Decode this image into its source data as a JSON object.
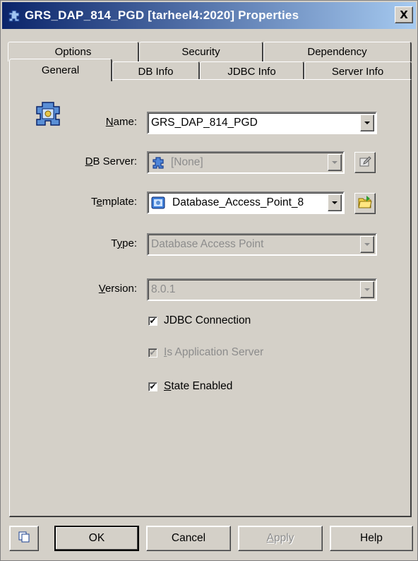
{
  "window": {
    "title": "GRS_DAP_814_PGD [tarheel4:2020] Properties",
    "close_label": "X",
    "title_color": "#0a246a"
  },
  "tabs": {
    "row_back": [
      "Options",
      "Security",
      "Dependency"
    ],
    "row_front": [
      "General",
      "DB Info",
      "JDBC Info",
      "Server Info"
    ],
    "active": "General"
  },
  "form": {
    "object_icon": "gear-object-icon",
    "name": {
      "label_u": "N",
      "label_rest": "ame:",
      "value": "GRS_DAP_814_PGD"
    },
    "db_server": {
      "label_u": "D",
      "label_rest": "B Server:",
      "value": "[None]",
      "icon": "puzzle-icon"
    },
    "template": {
      "label_pre": "T",
      "label_u": "e",
      "label_rest": "mplate:",
      "value": "Database_Access_Point_8",
      "icon": "template-icon"
    },
    "type": {
      "label_pre": "T",
      "label_u": "y",
      "label_rest": "pe:",
      "value": "Database Access Point"
    },
    "version": {
      "label_u": "V",
      "label_rest": "ersion:",
      "value": "8.0.1"
    },
    "checkboxes": [
      {
        "label": "JDBC Connection",
        "checked": true,
        "enabled": true
      },
      {
        "label_u": "I",
        "label_rest": "s Application Server",
        "checked": true,
        "enabled": false
      },
      {
        "label_u": "S",
        "label_rest": "tate Enabled",
        "checked": true,
        "enabled": true
      }
    ],
    "check_mark": "✔"
  },
  "buttons": {
    "ok": "OK",
    "cancel": "Cancel",
    "apply_u": "A",
    "apply_rest": "pply",
    "help": "Help",
    "copy_icon": "copy-icon"
  }
}
